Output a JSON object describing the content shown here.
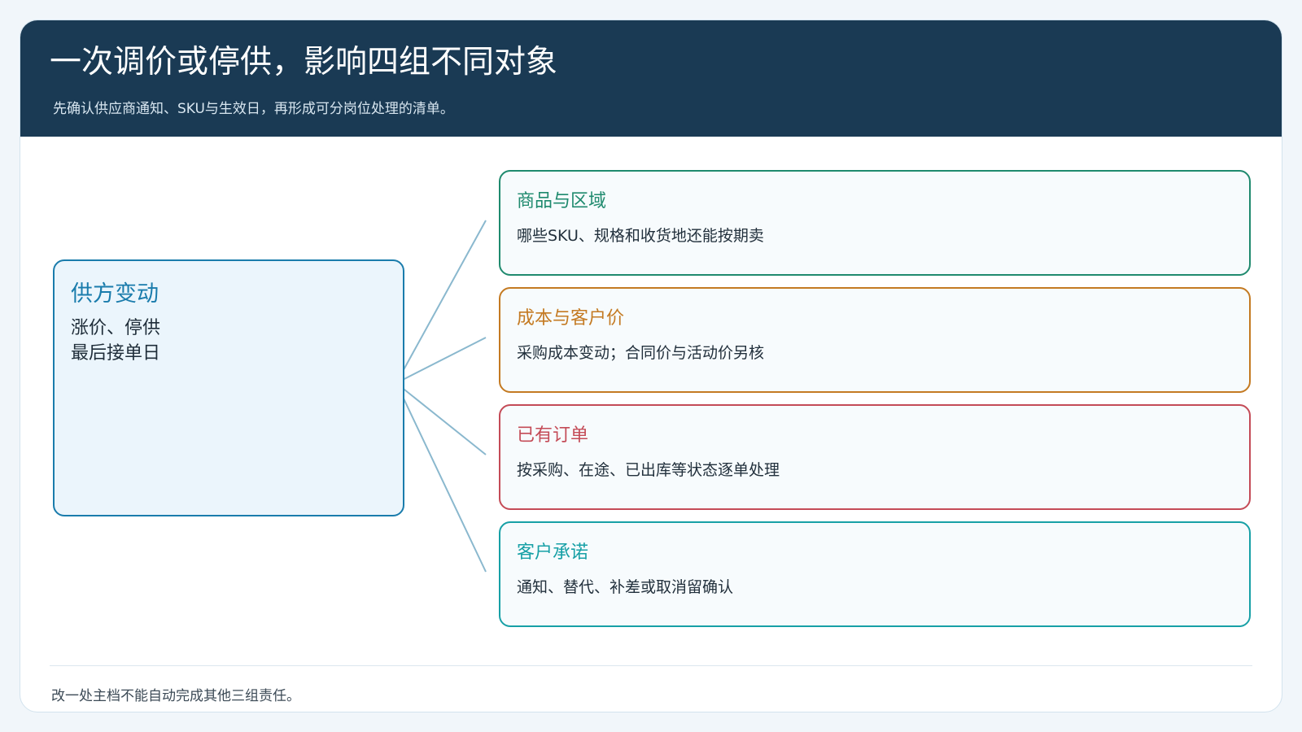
{
  "header": {
    "title": "一次调价或停供，影响四组不同对象",
    "subtitle": "先确认供应商通知、SKU与生效日，再形成可分岗位处理的清单。"
  },
  "source": {
    "title": "供方变动",
    "lines": [
      "涨价、停供",
      "最后接单日"
    ],
    "color": "#1a7cac"
  },
  "targets": [
    {
      "title": "商品与区域",
      "desc": "哪些SKU、规格和收货地还能按期卖",
      "color": "#1f8a6e"
    },
    {
      "title": "成本与客户价",
      "desc": "采购成本变动；合同价与活动价另核",
      "color": "#c47a22"
    },
    {
      "title": "已有订单",
      "desc": "按采购、在途、已出库等状态逐单处理",
      "color": "#c44b57"
    },
    {
      "title": "客户承诺",
      "desc": "通知、替代、补差或取消留确认",
      "color": "#17a0a6"
    }
  ],
  "footer": {
    "note": "改一处主档不能自动完成其他三组责任。"
  }
}
